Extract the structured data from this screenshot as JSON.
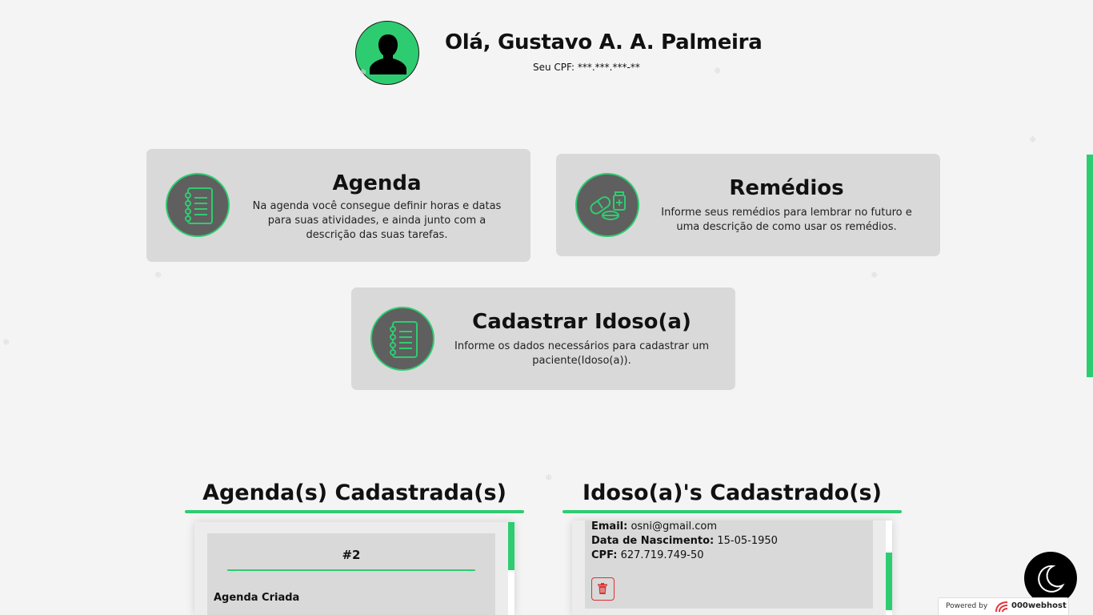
{
  "header": {
    "greeting": "Olá, Gustavo A. A. Palmeira",
    "cpf_text": "Seu CPF: ***.***.***-**",
    "avatar_icon": "user-silhouette-icon"
  },
  "cards": {
    "agenda": {
      "title": "Agenda",
      "description": "Na agenda você consegue definir horas e datas para suas atividades, e ainda junto com a descrição das suas tarefas.",
      "icon": "notebook-icon"
    },
    "remedios": {
      "title": "Remédios",
      "description": "Informe seus remédios para lembrar no futuro e uma descrição de como usar os remédios.",
      "icon": "pills-icon"
    },
    "cadastrar": {
      "title": "Cadastrar Idoso(a)",
      "description": "Informe os dados necessários para cadastrar um paciente(Idoso(a)).",
      "icon": "notebook-icon"
    }
  },
  "agendas_section": {
    "title": "Agenda(s) Cadastrada(s)",
    "items": [
      {
        "number": "#2",
        "label": "Agenda Criada"
      }
    ]
  },
  "idosos_section": {
    "title": "Idoso(a)'s Cadastrado(s)",
    "items": [
      {
        "email_label": "Email:",
        "email": "osni@gmail.com",
        "birth_label": "Data de Nascimento:",
        "birth": "15-05-1950",
        "cpf_label": "CPF:",
        "cpf": "627.719.749-50",
        "delete_icon": "trash-icon"
      }
    ]
  },
  "footer": {
    "powered_label": "Powered by",
    "brand": "000webhost",
    "dark_mode_icon": "moon-icon"
  },
  "colors": {
    "accent": "#2ecc71",
    "card_bg": "#d9d9d9",
    "icon_circle_bg": "#5f5f5f",
    "page_bg": "#f4f4f4",
    "danger": "#e03030"
  }
}
